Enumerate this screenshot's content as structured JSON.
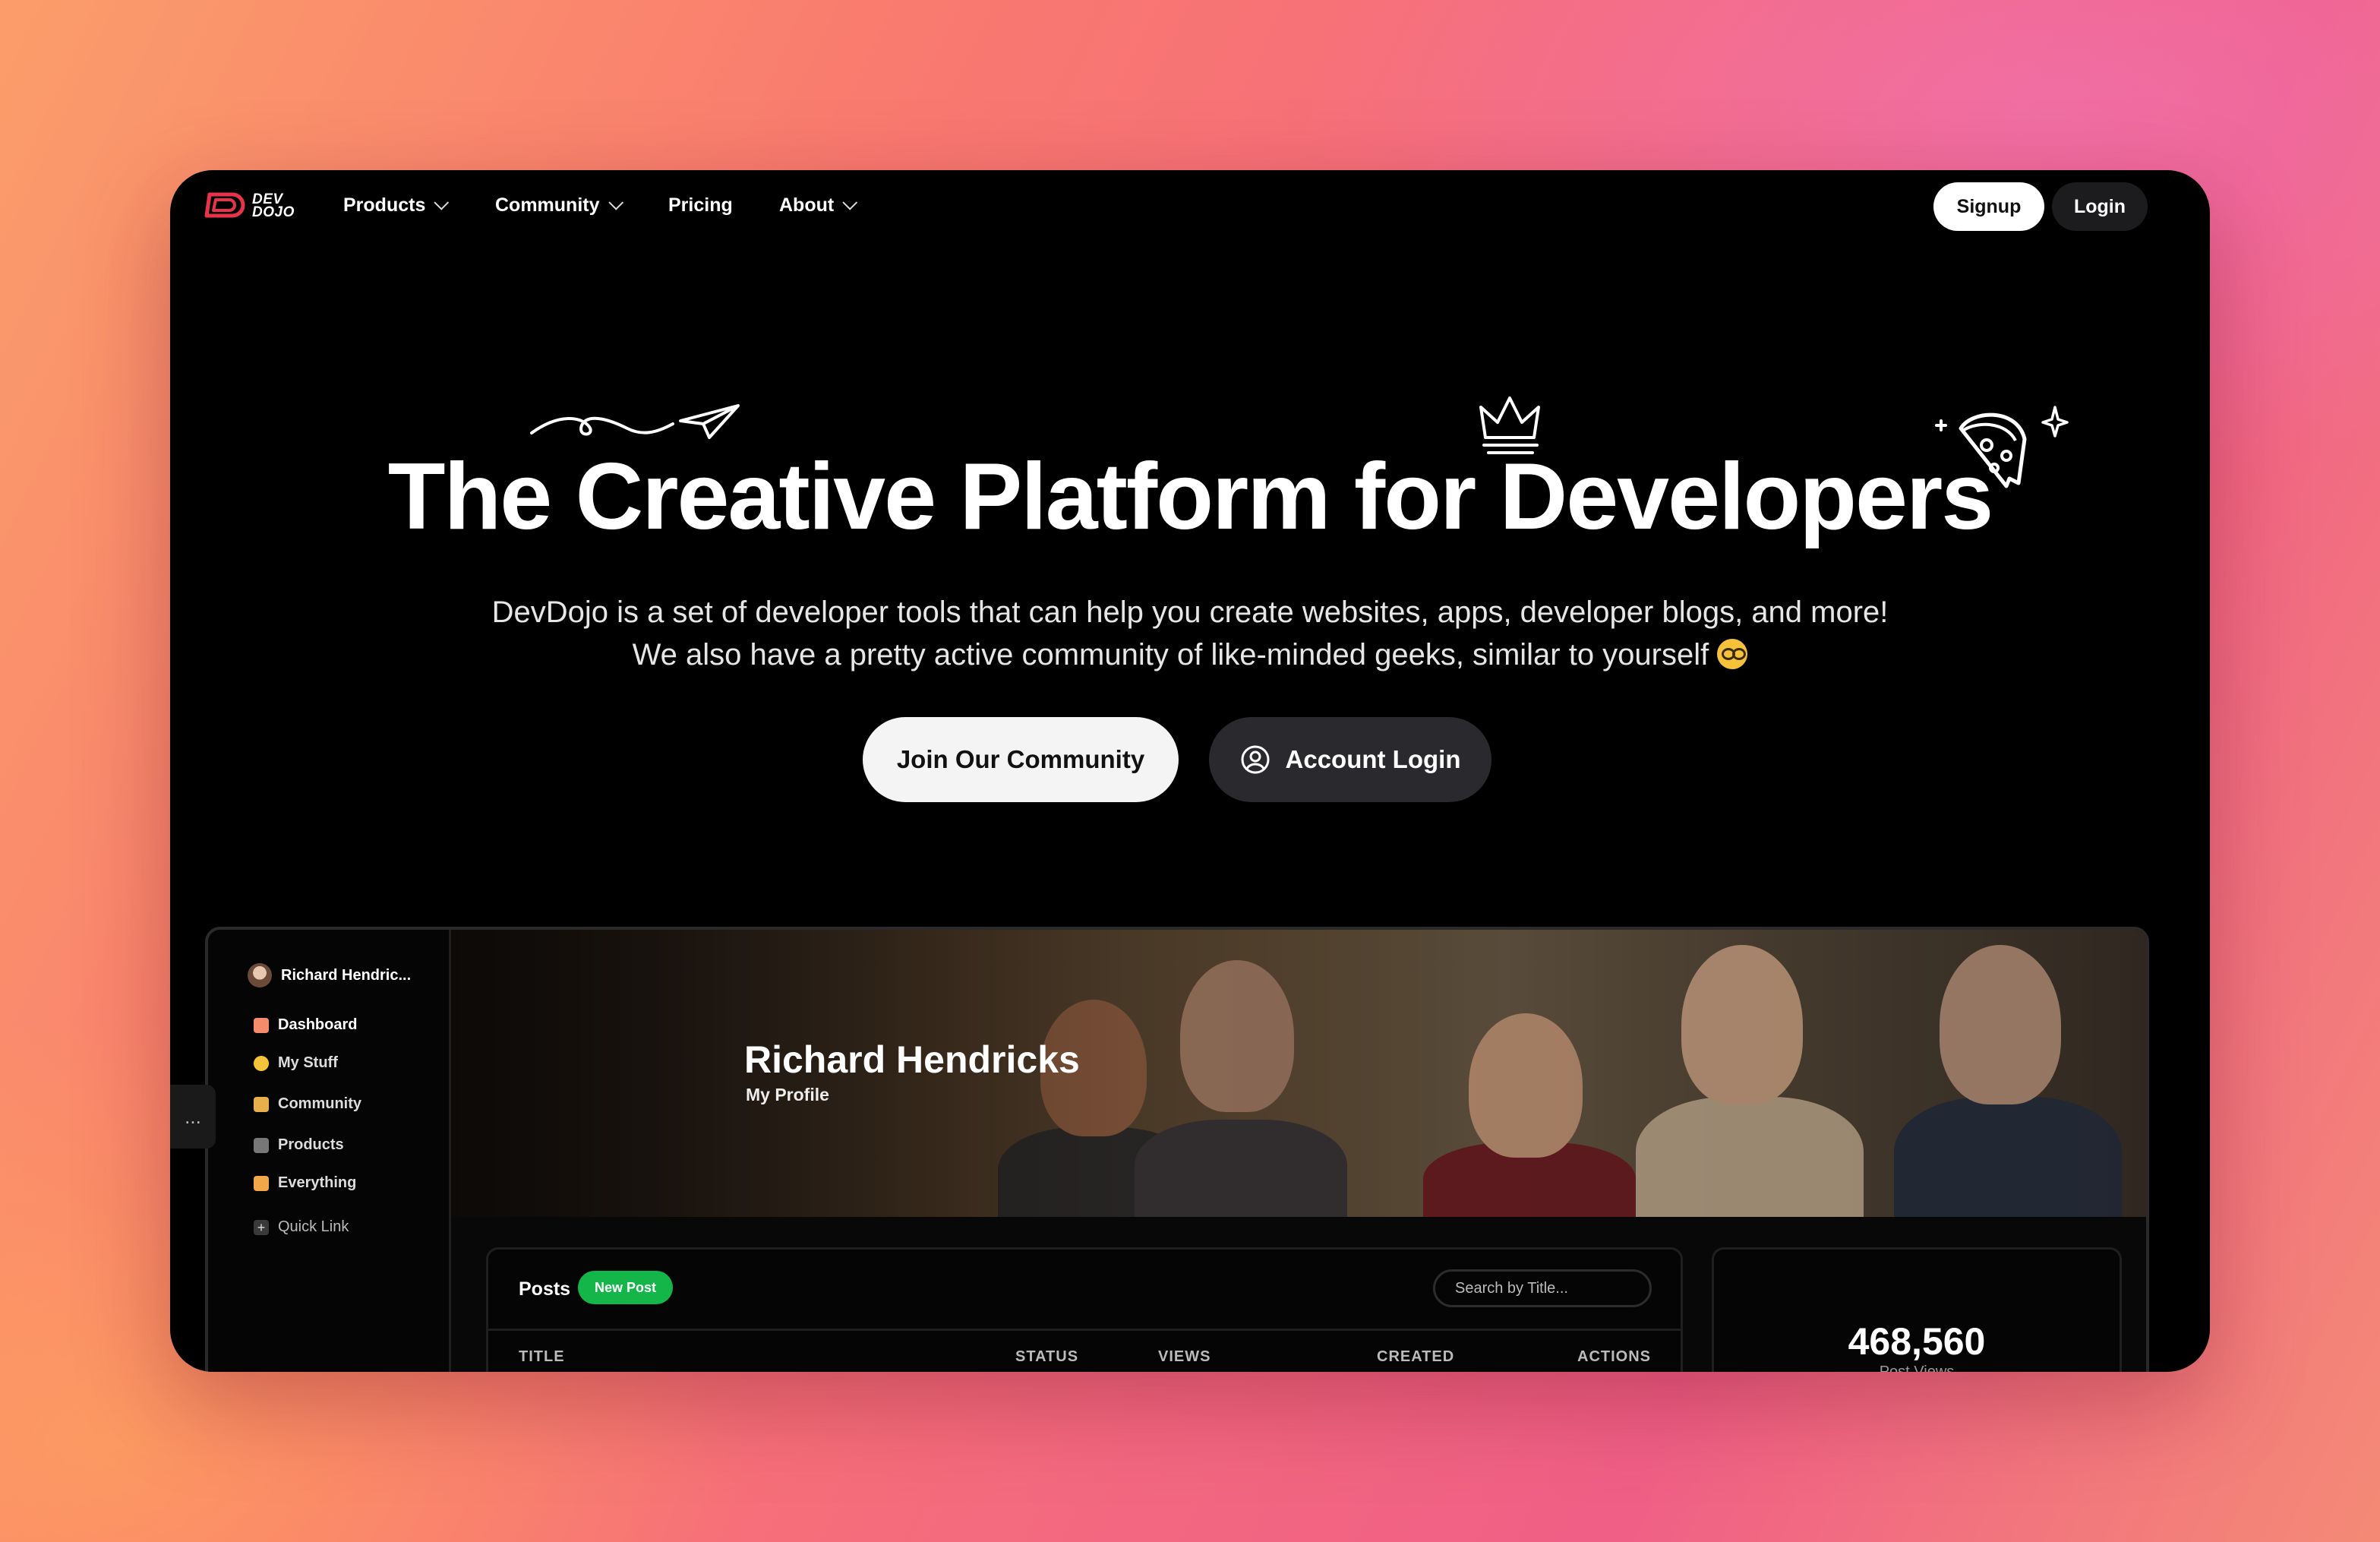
{
  "brand": {
    "logo_text_line1": "DEV",
    "logo_text_line2": "DOJO",
    "accent": "#e8344a"
  },
  "nav": {
    "items": [
      {
        "label": "Products",
        "has_dropdown": true
      },
      {
        "label": "Community",
        "has_dropdown": true
      },
      {
        "label": "Pricing",
        "has_dropdown": false
      },
      {
        "label": "About",
        "has_dropdown": true
      }
    ],
    "signup_label": "Signup",
    "login_label": "Login"
  },
  "hero": {
    "title": "The Creative Platform for Developers",
    "subtitle_line1": "DevDojo is a set of developer tools that can help you create websites, apps, developer blogs, and more!",
    "subtitle_line2": "We also have a pretty active community of like-minded geeks, similar to yourself",
    "primary_cta": "Join Our Community",
    "secondary_cta": "Account Login"
  },
  "dashboard": {
    "sidebar": {
      "user_name": "Richard Hendric...",
      "items": [
        {
          "label": "Dashboard",
          "icon": "house-icon",
          "color": "#f28c6a"
        },
        {
          "label": "My Stuff",
          "icon": "face-icon",
          "color": "#f6c23a"
        },
        {
          "label": "Community",
          "icon": "people-icon",
          "color": "#e8b04a"
        },
        {
          "label": "Products",
          "icon": "tools-icon",
          "color": "#9a9a9a"
        },
        {
          "label": "Everything",
          "icon": "grid-icon",
          "color": "#f2a84a"
        }
      ],
      "quick_link_label": "Quick Link",
      "handle_label": "..."
    },
    "banner": {
      "name": "Richard Hendricks",
      "subtitle": "My Profile"
    },
    "posts": {
      "title": "Posts",
      "new_post_label": "New Post",
      "search_placeholder": "Search by Title...",
      "columns": [
        "TITLE",
        "STATUS",
        "VIEWS",
        "CREATED",
        "ACTIONS"
      ]
    },
    "stats": {
      "value": "468,560",
      "label": "Post Views"
    }
  }
}
